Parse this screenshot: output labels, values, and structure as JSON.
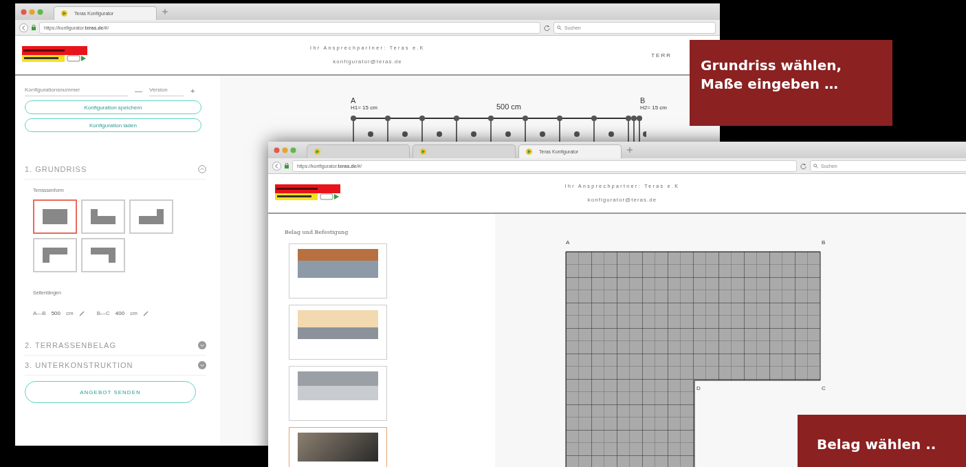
{
  "back_window": {
    "tabs": [
      {
        "label": "Teras Konfigurator",
        "selected": true
      }
    ],
    "url": "https://konfigurator.**teras.de**/#/",
    "search_placeholder": "Suchen",
    "header": {
      "contact": "Ihr Ansprechpartner: Teras e.K",
      "email": "konfigurator@teras.de",
      "right_text": "TERR"
    },
    "sidebar": {
      "config_number_placeholder": "Konfigurationsnummer",
      "version": {
        "minus": "—",
        "placeholder": "Version",
        "plus": "+"
      },
      "buttons": [
        "Konfiguration speichern",
        "Konfiguration laden"
      ],
      "sections": [
        {
          "title": "1. GRUNDRISS",
          "expanded": true
        },
        {
          "title": "2. TERRASSENBELAG",
          "expanded": false
        },
        {
          "title": "3. UNTERKONSTRUKTION",
          "expanded": false
        }
      ],
      "shape_label": "Terrassenform",
      "shapes": [
        {
          "kind": "rectangle",
          "selected": true
        },
        {
          "kind": "l-left-up",
          "selected": false
        },
        {
          "kind": "l-right-up",
          "selected": false
        },
        {
          "kind": "l-left-down",
          "selected": false
        },
        {
          "kind": "l-right-down",
          "selected": false
        }
      ],
      "lengths_label": "Seitenlängen",
      "lengths": [
        {
          "edge": "A—B",
          "value": "500",
          "unit": "cm"
        },
        {
          "edge": "B—C",
          "value": "400",
          "unit": "cm"
        }
      ],
      "send_button": "ANGEBOT SENDEN"
    },
    "diagram": {
      "corner_a": {
        "label": "A",
        "height": "H1= 15 cm"
      },
      "span": "500 cm",
      "corner_b": {
        "label": "B",
        "height": "H2= 15 cm"
      }
    }
  },
  "front_window": {
    "tabs": [
      {
        "selected": false
      },
      {
        "selected": false
      },
      {
        "label": "Teras Konfigurator",
        "selected": true
      }
    ],
    "url": "https://konfigurator.**teras.de**/#/",
    "search_placeholder": "Suchen",
    "header": {
      "contact": "Ihr Ansprechpartner: Teras e.K",
      "email": "konfigurator@teras.de"
    },
    "panel_title": "Belag und Befestigung",
    "products": [
      {
        "selected": false
      },
      {
        "selected": false
      },
      {
        "selected": false
      },
      {
        "selected": true
      }
    ],
    "plan": {
      "corners": [
        "A",
        "B",
        "D",
        "C"
      ]
    }
  },
  "banners": [
    {
      "lines": [
        "Grundriss wählen,",
        "Maße eingeben …"
      ]
    },
    {
      "lines": [
        "Belag wählen .."
      ]
    }
  ]
}
